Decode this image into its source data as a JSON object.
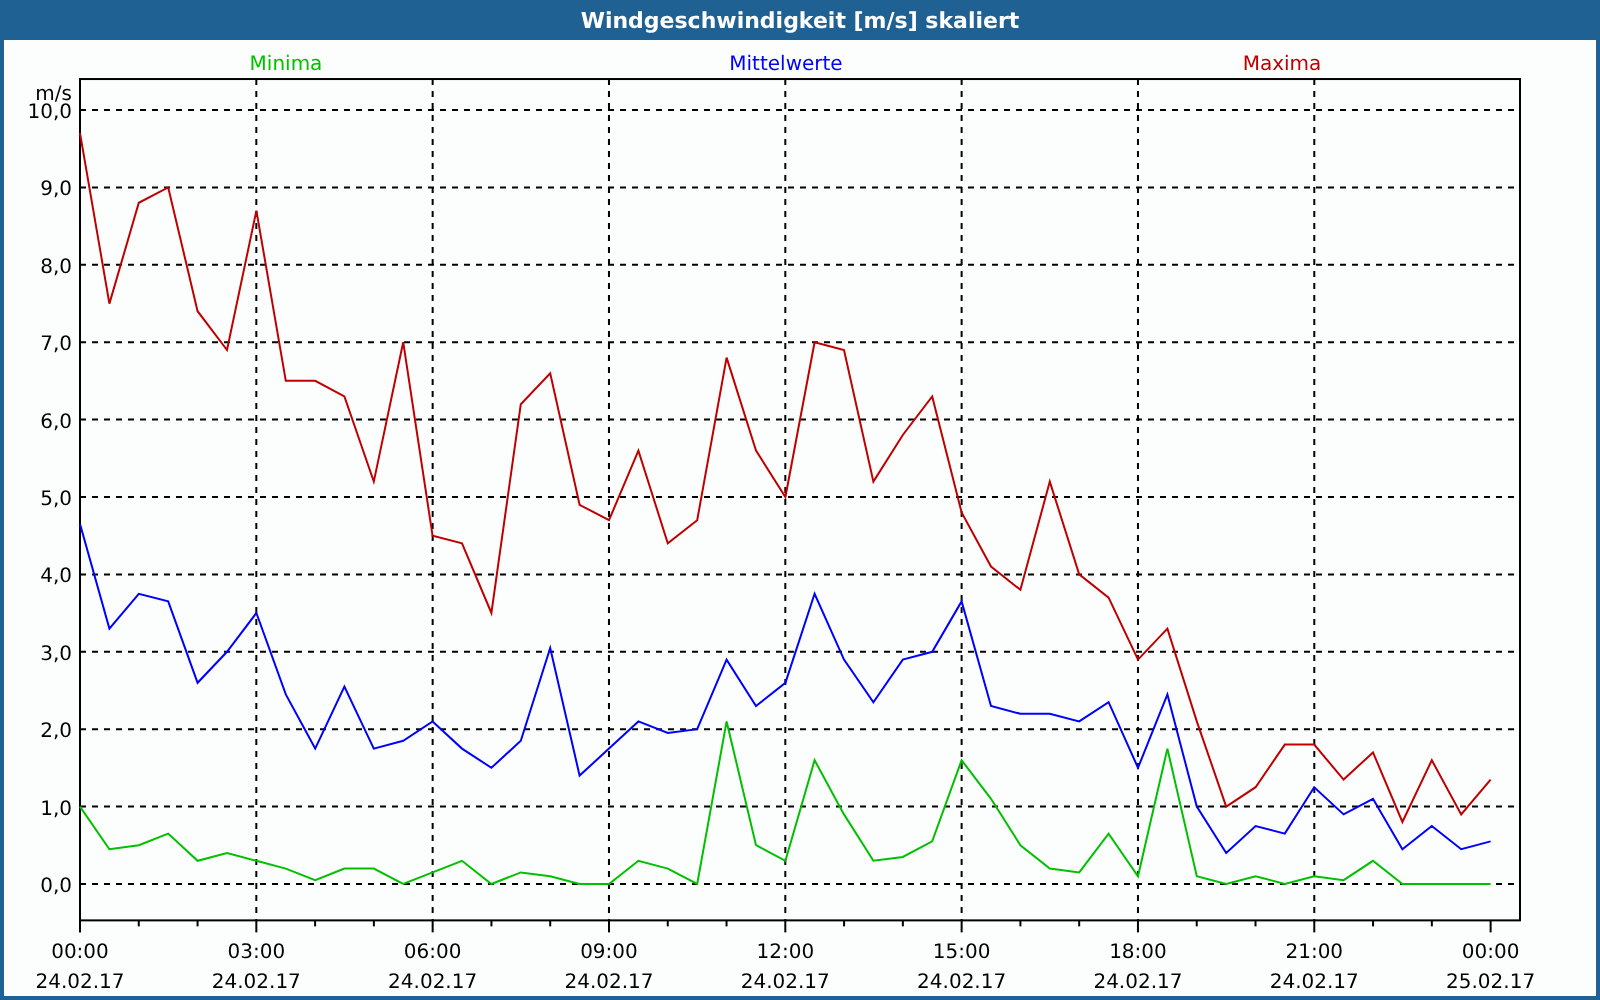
{
  "chart": {
    "x_axis_dates": [
      "24.02.17",
      "24.02.17",
      "24.02.17",
      "24.02.17",
      "24.02.17",
      "24.02.17",
      "24.02.17",
      "24.02.17",
      "25.02.17"
    ],
    "chart_data": {
      "type": "line",
      "title": "Windgeschwindigkeit [m/s] skaliert",
      "ylabel": "m/s",
      "grid": true,
      "x": [
        0,
        0.5,
        1,
        1.5,
        2,
        2.5,
        3,
        3.5,
        4,
        4.5,
        5,
        5.5,
        6,
        6.5,
        7,
        7.5,
        8,
        8.5,
        9,
        9.5,
        10,
        10.5,
        11,
        11.5,
        12,
        12.5,
        13,
        13.5,
        14,
        14.5,
        15,
        15.5,
        16,
        16.5,
        17,
        17.5,
        18,
        18.5,
        19,
        19.5,
        20,
        20.5,
        21,
        21.5,
        22,
        22.5,
        23,
        23.5,
        24
      ],
      "series": [
        {
          "name": "Minima",
          "color": "#00c000",
          "values": [
            1.0,
            0.45,
            0.5,
            0.65,
            0.3,
            0.4,
            0.3,
            0.2,
            0.05,
            0.2,
            0.2,
            0.0,
            0.15,
            0.3,
            0.0,
            0.15,
            0.1,
            0.0,
            0.0,
            0.3,
            0.2,
            0.0,
            2.1,
            0.5,
            0.3,
            1.6,
            0.9,
            0.3,
            0.35,
            0.55,
            1.6,
            1.1,
            0.5,
            0.2,
            0.15,
            0.65,
            0.1,
            1.75,
            0.1,
            0.0,
            0.1,
            0.0,
            0.1,
            0.05,
            0.3,
            0.0,
            0.0,
            0.0,
            0.0
          ]
        },
        {
          "name": "Mittelwerte",
          "color": "#0000ff",
          "values": [
            4.65,
            3.3,
            3.75,
            3.65,
            2.6,
            3.0,
            3.5,
            2.45,
            1.75,
            2.55,
            1.75,
            1.85,
            2.1,
            1.75,
            1.5,
            1.85,
            3.05,
            1.4,
            1.75,
            2.1,
            1.95,
            2.0,
            2.9,
            2.3,
            2.6,
            3.75,
            2.9,
            2.35,
            2.9,
            3.0,
            3.65,
            2.3,
            2.2,
            2.2,
            2.1,
            2.35,
            1.5,
            2.45,
            1.0,
            0.4,
            0.75,
            0.65,
            1.25,
            0.9,
            1.1,
            0.45,
            0.75,
            0.45,
            0.55
          ]
        },
        {
          "name": "Maxima",
          "color": "#c00000",
          "values": [
            9.7,
            7.5,
            8.8,
            9.0,
            7.4,
            6.9,
            8.7,
            6.5,
            6.5,
            6.3,
            5.2,
            7.0,
            4.5,
            4.4,
            3.5,
            6.2,
            6.6,
            4.9,
            4.7,
            5.6,
            4.4,
            4.7,
            6.8,
            5.6,
            5.0,
            7.0,
            6.9,
            5.2,
            5.8,
            6.3,
            4.8,
            4.1,
            3.8,
            5.2,
            4.0,
            3.7,
            2.9,
            3.3,
            2.1,
            1.0,
            1.25,
            1.8,
            1.8,
            1.35,
            1.7,
            0.8,
            1.6,
            0.9,
            1.35
          ]
        }
      ],
      "xlim": [
        0,
        24.5
      ],
      "ylim": [
        -0.47,
        10.4
      ],
      "xticks": [
        {
          "value": 0,
          "label": "00:00"
        },
        {
          "value": 3,
          "label": "03:00"
        },
        {
          "value": 6,
          "label": "06:00"
        },
        {
          "value": 9,
          "label": "09:00"
        },
        {
          "value": 12,
          "label": "12:00"
        },
        {
          "value": 15,
          "label": "15:00"
        },
        {
          "value": 18,
          "label": "18:00"
        },
        {
          "value": 21,
          "label": "21:00"
        },
        {
          "value": 24,
          "label": "00:00"
        }
      ],
      "yticks": [
        {
          "value": 0,
          "label": "0,0"
        },
        {
          "value": 1,
          "label": "1,0"
        },
        {
          "value": 2,
          "label": "2,0"
        },
        {
          "value": 3,
          "label": "3,0"
        },
        {
          "value": 4,
          "label": "4,0"
        },
        {
          "value": 5,
          "label": "5,0"
        },
        {
          "value": 6,
          "label": "6,0"
        },
        {
          "value": 7,
          "label": "7,0"
        },
        {
          "value": 8,
          "label": "8,0"
        },
        {
          "value": 9,
          "label": "9,0"
        },
        {
          "value": 10,
          "label": "10,0"
        }
      ]
    }
  }
}
